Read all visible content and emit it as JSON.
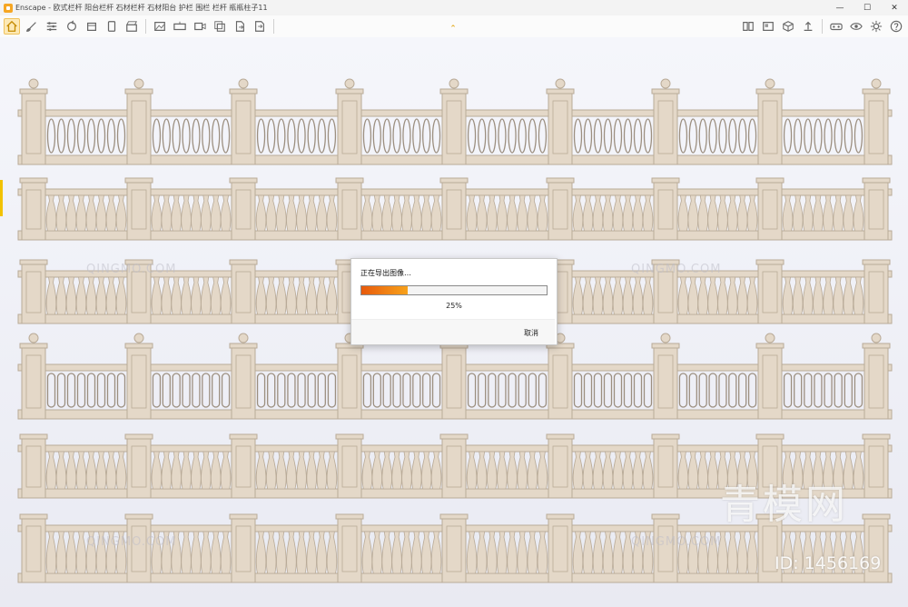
{
  "window": {
    "title": "Enscape - 欧式栏杆 阳台栏杆 石材栏杆 石材阳台 护栏 围栏 栏杆 瓶瓶柱子11",
    "controls": [
      "minimize-icon",
      "maximize-icon",
      "close-icon"
    ]
  },
  "toolbar": {
    "left_icons": [
      "home-icon",
      "brush-icon",
      "settings-sliders-icon",
      "sync-icon",
      "package-icon",
      "tablet-icon",
      "clapperboard-icon",
      "image-export-icon",
      "panorama-export-icon",
      "video-export-icon",
      "batch-export-icon",
      "export-file-icon",
      "web-export-icon"
    ],
    "right_icons": [
      "asset-library-icon",
      "material-editor-icon",
      "cube-icon",
      "upload-icon",
      "vr-headset-icon",
      "eye-icon",
      "settings-gear-icon",
      "help-icon"
    ],
    "active": "home-icon",
    "accent": "#f0c25c"
  },
  "dialog": {
    "title": "正在导出图像…",
    "progress": 0.25,
    "percent_text": "25%",
    "cancel_label": "取消",
    "bar_color": "#f07010"
  },
  "watermark": {
    "brand_cn": "青模网",
    "brand_en": "QINGMO.COM",
    "id_text": "ID: 1456169"
  },
  "scene": {
    "stone_color": "#e4d8c8",
    "shadow_color": "#b9ab98",
    "railing_rows": 6
  }
}
